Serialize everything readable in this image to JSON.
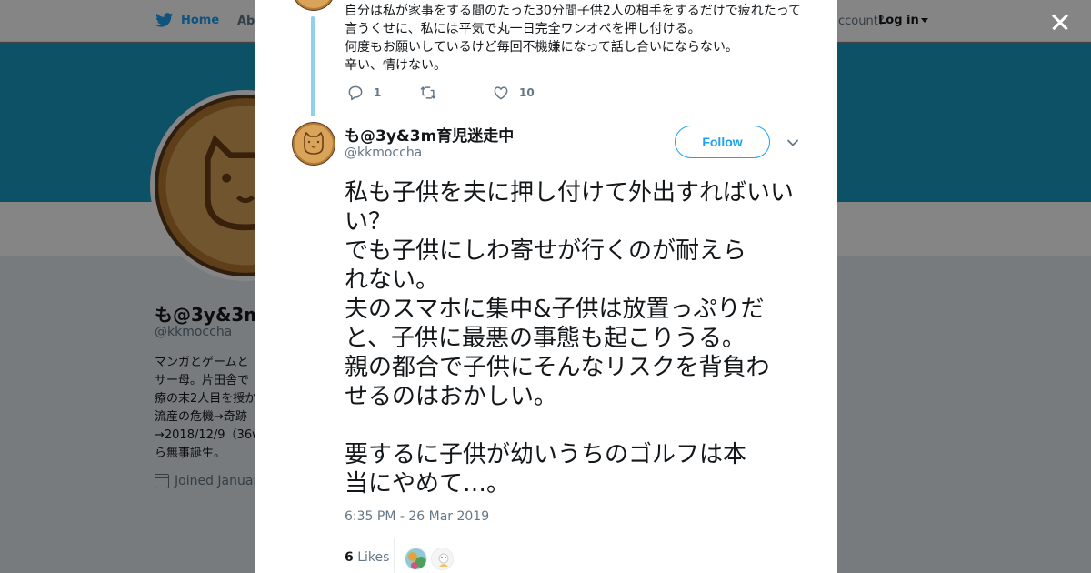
{
  "nav": {
    "home": "Home",
    "about": "Abo",
    "account": "ccount?",
    "login": "Log in"
  },
  "profile": {
    "name": "も@3y&3m",
    "handle": "@kkmoccha",
    "bio_lines": [
      "マンガとゲームと",
      "サー母。片田舎で",
      "療の末2人目を授か",
      "流産の危機→奇跡",
      "→2018/12/9（36w",
      "ら無事誕生。"
    ],
    "joined": "Joined Januar"
  },
  "prev_tweet": {
    "lines": [
      "自分は私が家事をする間のたった30分間子供2人の相手をするだけで疲れたって",
      "言うくせに、私には平気で丸一日完全ワンオペを押し付ける。",
      "何度もお願いしているけど毎回不機嫌になって話し合いにならない。",
      "辛い、情けない。"
    ],
    "replies": "1",
    "retweets": "",
    "likes": "10"
  },
  "tweet": {
    "name": "も@3y&3m育児迷走中",
    "handle": "@kkmoccha",
    "follow_label": "Follow",
    "lines": [
      "私も子供を夫に押し付けて外出すればいい",
      "い？",
      "でも子供にしわ寄せが行くのが耐えら",
      "れない。",
      "夫のスマホに集中&子供は放置っぷりだ",
      "と、子供に最悪の事態も起こりうる。",
      "親の都合で子供にそんなリスクを背負わ",
      "せるのはおかしい。",
      "",
      "要するに子供が幼いうちのゴルフは本",
      "当にやめて…。"
    ],
    "timestamp": "6:35 PM - 26 Mar 2019",
    "likes_count": "6",
    "likes_label": "Likes"
  },
  "colors": {
    "accent": "#1da1f2",
    "banner": "#1a9bc4",
    "thread_line": "#8fd1e8"
  },
  "icons": [
    "twitter-bird-icon",
    "close-icon",
    "reply-icon",
    "retweet-icon",
    "heart-icon",
    "chevron-down-icon",
    "calendar-icon"
  ]
}
